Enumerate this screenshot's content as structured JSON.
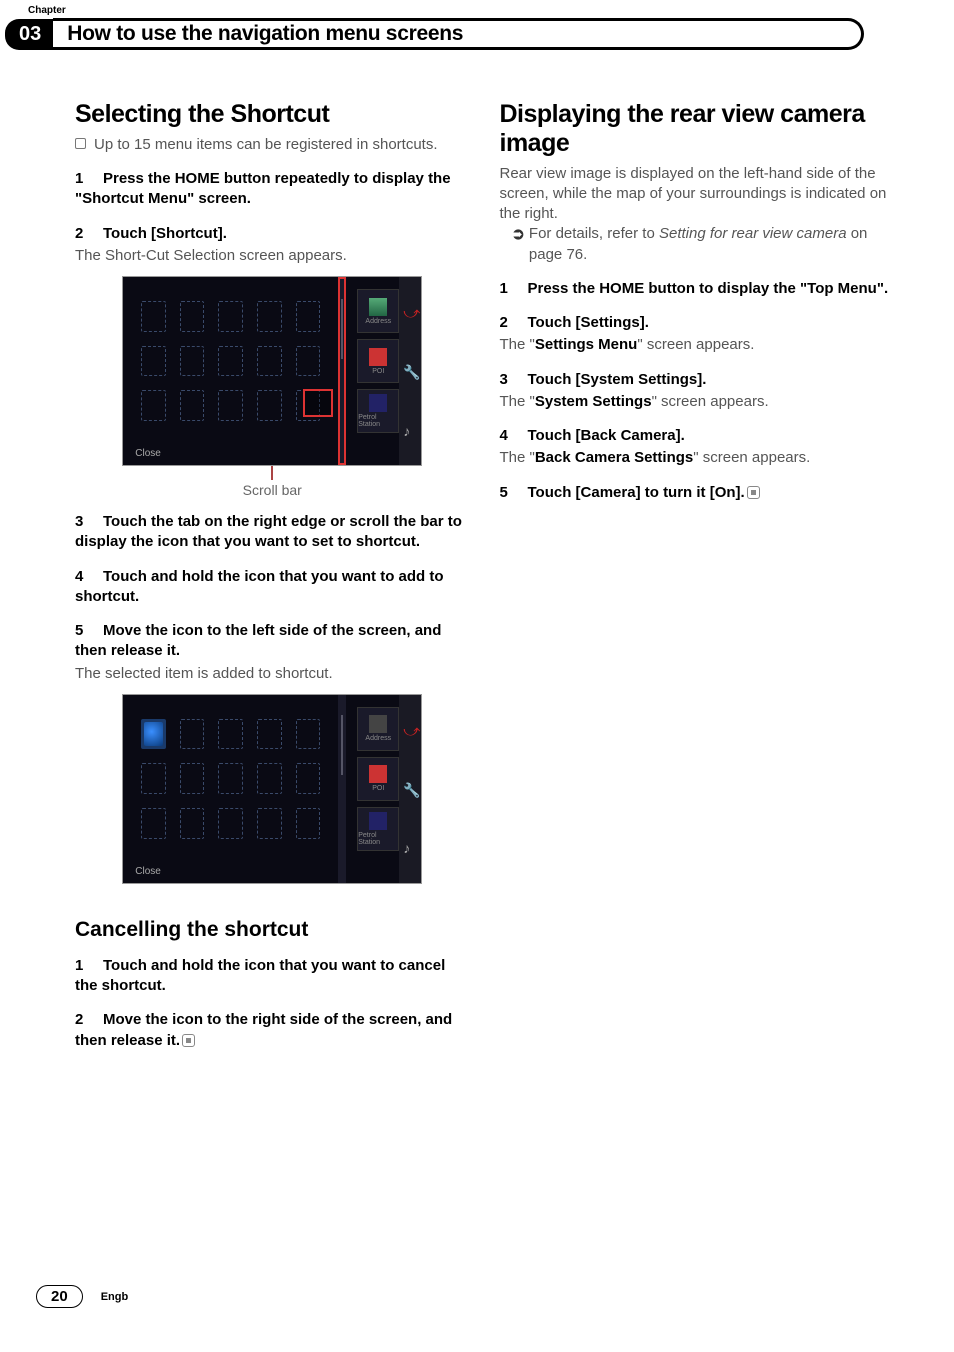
{
  "chapter": {
    "label": "Chapter",
    "number": "03",
    "title": "How to use the navigation menu screens"
  },
  "left": {
    "title": "Selecting the Shortcut",
    "bullet": "Up to 15 menu items can be registered in shortcuts.",
    "step1": "Press the HOME button repeatedly to display the \"Shortcut Menu\" screen.",
    "step2": "Touch [Shortcut].",
    "step2_follow": "The Short-Cut Selection screen appears.",
    "fig1": {
      "close": "Close",
      "side1": "Address",
      "side2": "POI",
      "side3": "Petrol Station",
      "caption": "Scroll bar"
    },
    "step3": "Touch the tab on the right edge or scroll the bar to display the icon that you want to set to shortcut.",
    "step4": "Touch and hold the icon that you want to add to shortcut.",
    "step5": "Move the icon to the left side of the screen, and then release it.",
    "step5_follow": "The selected item is added to shortcut.",
    "fig2": {
      "close": "Close",
      "side1": "Address",
      "side2": "POI",
      "side3": "Petrol Station"
    },
    "cancel_title": "Cancelling the shortcut",
    "cstep1": "Touch and hold the icon that you want to cancel the shortcut.",
    "cstep2": "Move the icon to the right side of the screen, and then release it."
  },
  "right": {
    "title": "Displaying the rear view camera image",
    "intro": "Rear view image is displayed on the left-hand side of the screen, while the map of your surroundings is indicated on the right.",
    "ref_prefix": "For details, refer to ",
    "ref_italic": "Setting for rear view camera",
    "ref_suffix": " on page 76.",
    "step1": "Press the HOME button to display the \"Top Menu\".",
    "step2": "Touch [Settings].",
    "step2_follow_prefix": "The \"",
    "step2_follow_bold": "Settings Menu",
    "step2_follow_suffix": "\" screen appears.",
    "step3": "Touch [System Settings].",
    "step3_follow_prefix": "The \"",
    "step3_follow_bold": "System Settings",
    "step3_follow_suffix": "\" screen appears.",
    "step4": "Touch [Back Camera].",
    "step4_follow_prefix": "The \"",
    "step4_follow_bold": "Back Camera Settings",
    "step4_follow_suffix": "\" screen appears.",
    "step5": "Touch [Camera] to turn it [On]."
  },
  "footer": {
    "page": "20",
    "lang": "Engb"
  }
}
